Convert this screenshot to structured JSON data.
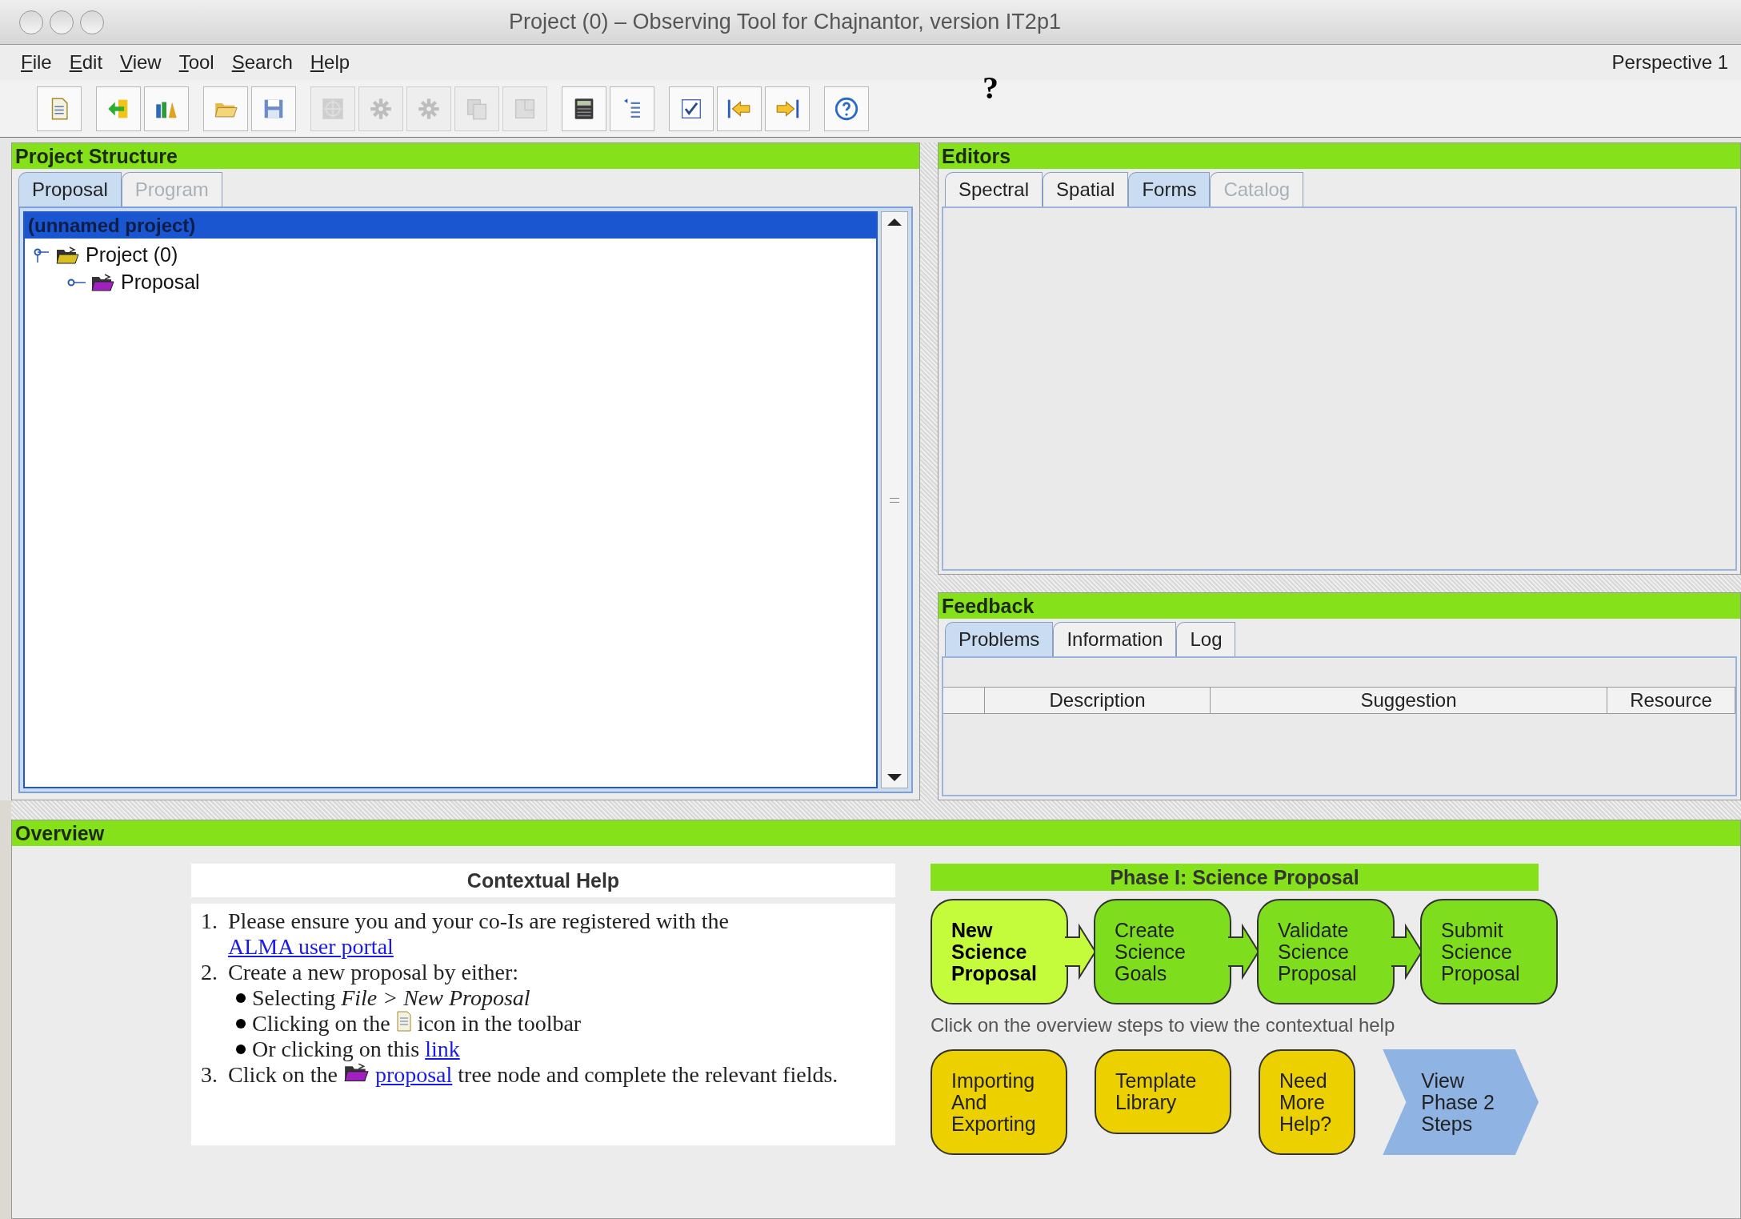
{
  "window": {
    "title": "Project (0) – Observing Tool for Chajnantor, version IT2p1"
  },
  "menu": [
    {
      "key": "F",
      "rest": "ile"
    },
    {
      "key": "E",
      "rest": "dit"
    },
    {
      "key": "V",
      "rest": "iew"
    },
    {
      "key": "T",
      "rest": "ool"
    },
    {
      "key": "S",
      "rest": "earch"
    },
    {
      "key": "H",
      "rest": "elp"
    }
  ],
  "perspective": "Perspective 1",
  "floating_mark": "?",
  "toolbar": {
    "groups": [
      [
        {
          "kind": "document",
          "disabled": false
        }
      ],
      [
        {
          "kind": "import",
          "disabled": false
        },
        {
          "kind": "books",
          "disabled": false
        }
      ],
      [
        {
          "kind": "folder",
          "disabled": false
        },
        {
          "kind": "save",
          "disabled": false
        }
      ],
      [
        {
          "kind": "target",
          "disabled": true
        },
        {
          "kind": "gear",
          "disabled": true
        },
        {
          "kind": "gear",
          "disabled": true
        },
        {
          "kind": "copy",
          "disabled": true
        },
        {
          "kind": "panel",
          "disabled": true
        }
      ],
      [
        {
          "kind": "calculator",
          "disabled": false
        },
        {
          "kind": "list",
          "disabled": false
        }
      ],
      [
        {
          "kind": "checkbox",
          "disabled": false
        },
        {
          "kind": "arrow_left",
          "disabled": false
        },
        {
          "kind": "arrow_right",
          "disabled": false
        }
      ],
      [
        {
          "kind": "help",
          "disabled": false
        }
      ]
    ]
  },
  "project_structure": {
    "title": "Project Structure",
    "tabs": [
      {
        "label": "Proposal",
        "selected": true,
        "disabled": false
      },
      {
        "label": "Program",
        "selected": false,
        "disabled": true
      }
    ],
    "tree": {
      "header": "(unnamed project)",
      "nodes": [
        {
          "label": "Project (0)",
          "kind": "project",
          "expanded": true,
          "children": [
            {
              "label": "Proposal",
              "kind": "proposal",
              "expanded": false
            }
          ]
        }
      ]
    }
  },
  "editors": {
    "title": "Editors",
    "tabs": [
      {
        "label": "Spectral",
        "selected": false,
        "disabled": false
      },
      {
        "label": "Spatial",
        "selected": false,
        "disabled": false
      },
      {
        "label": "Forms",
        "selected": true,
        "disabled": false
      },
      {
        "label": "Catalog",
        "selected": false,
        "disabled": true
      }
    ]
  },
  "feedback": {
    "title": "Feedback",
    "tabs": [
      {
        "label": "Problems",
        "selected": true,
        "disabled": false
      },
      {
        "label": "Information",
        "selected": false,
        "disabled": false
      },
      {
        "label": "Log",
        "selected": false,
        "disabled": false
      }
    ],
    "table": {
      "columns": [
        "Description",
        "Suggestion",
        "Resource"
      ]
    }
  },
  "overview": {
    "title": "Overview",
    "help": {
      "title": "Contextual Help",
      "items": [
        {
          "number": "1.",
          "segments": [
            {
              "kind": "text",
              "text": "Please ensure you and your co-Is are registered with the "
            },
            {
              "kind": "link",
              "text": "ALMA user portal"
            }
          ]
        },
        {
          "number": "2.",
          "segments": [
            {
              "kind": "text",
              "text": "Create a new proposal by either:"
            }
          ],
          "bullets": [
            {
              "segments": [
                {
                  "kind": "text",
                  "text": "Selecting *File > New Proposal*"
                }
              ]
            },
            {
              "segments": [
                {
                  "kind": "text",
                  "text": "Clicking on the "
                },
                {
                  "kind": "document_icon"
                },
                {
                  "kind": "text",
                  "text": " icon in the toolbar"
                }
              ]
            },
            {
              "segments": [
                {
                  "kind": "text",
                  "text": "Or clicking on this "
                },
                {
                  "kind": "link",
                  "text": "link"
                }
              ]
            }
          ]
        },
        {
          "number": "3.",
          "segments": [
            {
              "kind": "text",
              "text": "Click on the "
            },
            {
              "kind": "folder_icon"
            },
            {
              "kind": "link",
              "text": "proposal"
            },
            {
              "kind": "text",
              "text": " tree node and complete the relevant fields."
            }
          ]
        }
      ]
    },
    "phase": {
      "title": "Phase I: Science Proposal",
      "steps": [
        {
          "label": "New\nScience\nProposal",
          "selected": true
        },
        {
          "label": "Create\nScience\nGoals",
          "selected": false
        },
        {
          "label": "Validate\nScience\nProposal",
          "selected": false
        },
        {
          "label": "Submit\nScience\nProposal",
          "selected": false
        }
      ],
      "hint": "Click on the overview steps to view the contextual help",
      "extras": [
        {
          "label": "Importing\nAnd\nExporting",
          "kind": "task"
        },
        {
          "label": "Template\nLibrary",
          "kind": "task"
        },
        {
          "label": "Need\nMore\nHelp?",
          "kind": "task"
        },
        {
          "label": "View\nPhase 2\nSteps",
          "kind": "next_phase"
        }
      ]
    }
  }
}
